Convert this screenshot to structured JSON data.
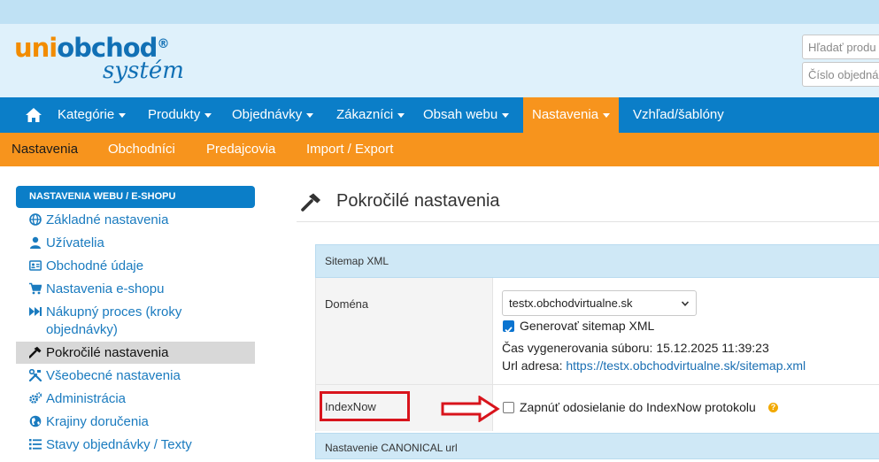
{
  "logo": {
    "main_uni": "uni",
    "main_obchod": "obchod",
    "reg": "®",
    "sub": "systém"
  },
  "header": {
    "search_placeholder_1": "Hľadať produ",
    "search_placeholder_2": "Číslo objedná"
  },
  "nav": {
    "items": [
      {
        "label": "Kategórie"
      },
      {
        "label": "Produkty"
      },
      {
        "label": "Objednávky"
      },
      {
        "label": "Zákazníci"
      },
      {
        "label": "Obsah webu"
      },
      {
        "label": "Nastavenia"
      },
      {
        "label": "Vzhľad/šablóny"
      }
    ]
  },
  "subnav": {
    "items": [
      {
        "label": "Nastavenia"
      },
      {
        "label": "Obchodníci"
      },
      {
        "label": "Predajcovia"
      },
      {
        "label": "Import / Export"
      }
    ]
  },
  "sidebar": {
    "heading": "NASTAVENIA WEBU / E-SHOPU",
    "items": [
      {
        "label": "Základné nastavenia",
        "icon": "globe-icon"
      },
      {
        "label": "Užívatelia",
        "icon": "user-icon"
      },
      {
        "label": "Obchodné údaje",
        "icon": "id-card-icon"
      },
      {
        "label": "Nastavenia e-shopu",
        "icon": "cart-icon"
      },
      {
        "label": "Nákupný proces (kroky objednávky)",
        "icon": "fast-forward-icon"
      },
      {
        "label": "Pokročilé nastavenia",
        "icon": "hammer-icon"
      },
      {
        "label": "Všeobecné nastavenia",
        "icon": "tools-icon"
      },
      {
        "label": "Administrácia",
        "icon": "cogs-icon"
      },
      {
        "label": "Krajiny doručenia",
        "icon": "globe-europe-icon"
      },
      {
        "label": "Stavy objednávky / Texty",
        "icon": "list-icon"
      }
    ]
  },
  "main": {
    "title": "Pokročilé nastavenia",
    "sitemap_section": "Sitemap XML",
    "domain_label": "Doména",
    "domain_value": "testx.obchodvirtualne.sk",
    "generate_label": "Generovať sitemap XML",
    "generated_time": "Čas vygenerovania súboru: 15.12.2025 11:39:23",
    "url_label": "Url adresa: ",
    "url_value": "https://testx.obchodvirtualne.sk/sitemap.xml",
    "indexnow_label": "IndexNow",
    "indexnow_checkbox": "Zapnúť odosielanie do IndexNow protokolu",
    "help_glyph": "?",
    "canonical_section": "Nastavenie CANONICAL url"
  },
  "colors": {
    "nav": "#0b7ec8",
    "accent": "#f7941d",
    "highlight": "#d8141c"
  }
}
